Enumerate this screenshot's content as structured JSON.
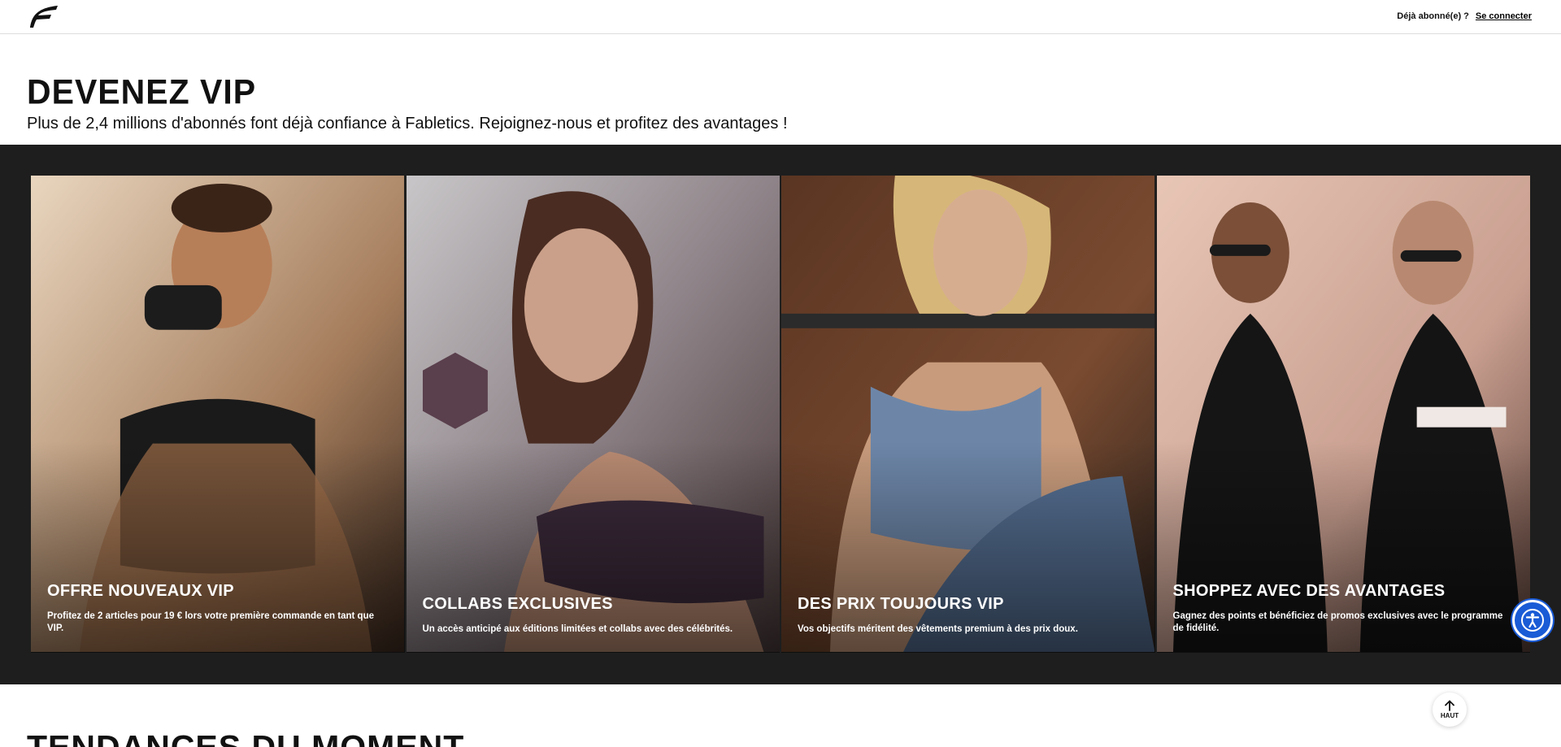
{
  "header": {
    "already_member": "Déjà abonné(e) ?",
    "login_label": "Se connecter"
  },
  "hero": {
    "title": "DEVENEZ VIP",
    "subtitle": "Plus de 2,4 millions d'abonnés font déjà confiance à Fabletics. Rejoignez-nous et profitez des avantages !"
  },
  "cards": [
    {
      "title": "OFFRE NOUVEAUX VIP",
      "description": "Profitez de 2 articles pour 19 € lors votre première commande en tant que VIP."
    },
    {
      "title": "COLLABS EXCLUSIVES",
      "description": "Un accès anticipé aux éditions limitées et collabs avec des célébrités."
    },
    {
      "title": "DES PRIX TOUJOURS VIP",
      "description": "Vos objectifs méritent des vêtements premium à des prix doux."
    },
    {
      "title": "SHOPPEZ AVEC DES AVANTAGES",
      "description": "Gagnez des points et bénéficiez de promos exclusives avec le programme de fidélité."
    }
  ],
  "next_section": {
    "title": "TENDANCES DU MOMENT"
  },
  "back_to_top": {
    "label": "HAUT"
  },
  "icons": {
    "logo": "fabletics-logo-icon",
    "back_to_top": "arrow-up-icon",
    "accessibility": "accessibility-icon"
  },
  "colors": {
    "band": "#1e1e1e",
    "accessibility_button": "#1a5bd6"
  }
}
